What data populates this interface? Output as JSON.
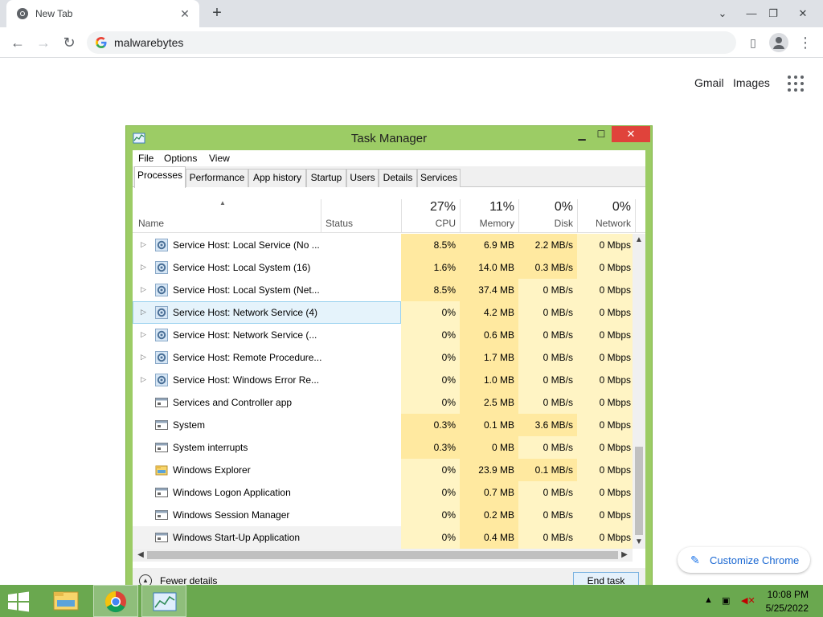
{
  "browser": {
    "tab_title": "New Tab",
    "omnibox_text": "malwarebytes",
    "ntp_links": [
      "Gmail",
      "Images"
    ],
    "customize_label": "Customize Chrome"
  },
  "task_manager": {
    "title": "Task Manager",
    "menu": [
      "File",
      "Options",
      "View"
    ],
    "tabs": [
      "Processes",
      "Performance",
      "App history",
      "Startup",
      "Users",
      "Details",
      "Services"
    ],
    "active_tab": "Processes",
    "columns": {
      "name": "Name",
      "status": "Status",
      "cpu": {
        "pct": "27%",
        "label": "CPU"
      },
      "memory": {
        "pct": "11%",
        "label": "Memory"
      },
      "disk": {
        "pct": "0%",
        "label": "Disk"
      },
      "network": {
        "pct": "0%",
        "label": "Network"
      }
    },
    "rows": [
      {
        "name": "Service Host: Local Service (No ...",
        "expandable": true,
        "icon": "gear-icon",
        "cpu": "8.5%",
        "memory": "6.9 MB",
        "disk": "2.2 MB/s",
        "network": "0 Mbps"
      },
      {
        "name": "Service Host: Local System (16)",
        "expandable": true,
        "icon": "gear-icon",
        "cpu": "1.6%",
        "memory": "14.0 MB",
        "disk": "0.3 MB/s",
        "network": "0 Mbps"
      },
      {
        "name": "Service Host: Local System (Net...",
        "expandable": true,
        "icon": "gear-icon",
        "cpu": "8.5%",
        "memory": "37.4 MB",
        "disk": "0 MB/s",
        "network": "0 Mbps"
      },
      {
        "name": "Service Host: Network Service (4)",
        "expandable": true,
        "icon": "gear-icon",
        "cpu": "0%",
        "memory": "4.2 MB",
        "disk": "0 MB/s",
        "network": "0 Mbps"
      },
      {
        "name": "Service Host: Network Service (...",
        "expandable": true,
        "icon": "gear-icon",
        "cpu": "0%",
        "memory": "0.6 MB",
        "disk": "0 MB/s",
        "network": "0 Mbps"
      },
      {
        "name": "Service Host: Remote Procedure...",
        "expandable": true,
        "icon": "gear-icon",
        "cpu": "0%",
        "memory": "1.7 MB",
        "disk": "0 MB/s",
        "network": "0 Mbps"
      },
      {
        "name": "Service Host: Windows Error Re...",
        "expandable": true,
        "icon": "gear-icon",
        "cpu": "0%",
        "memory": "1.0 MB",
        "disk": "0 MB/s",
        "network": "0 Mbps"
      },
      {
        "name": "Services and Controller app",
        "expandable": false,
        "icon": "window-icon",
        "cpu": "0%",
        "memory": "2.5 MB",
        "disk": "0 MB/s",
        "network": "0 Mbps"
      },
      {
        "name": "System",
        "expandable": false,
        "icon": "window-icon",
        "cpu": "0.3%",
        "memory": "0.1 MB",
        "disk": "3.6 MB/s",
        "network": "0 Mbps"
      },
      {
        "name": "System interrupts",
        "expandable": false,
        "icon": "window-icon",
        "cpu": "0.3%",
        "memory": "0 MB",
        "disk": "0 MB/s",
        "network": "0 Mbps"
      },
      {
        "name": "Windows Explorer",
        "expandable": false,
        "icon": "folder-icon",
        "cpu": "0%",
        "memory": "23.9 MB",
        "disk": "0.1 MB/s",
        "network": "0 Mbps"
      },
      {
        "name": "Windows Logon Application",
        "expandable": false,
        "icon": "window-icon",
        "cpu": "0%",
        "memory": "0.7 MB",
        "disk": "0 MB/s",
        "network": "0 Mbps"
      },
      {
        "name": "Windows Session Manager",
        "expandable": false,
        "icon": "window-icon",
        "cpu": "0%",
        "memory": "0.2 MB",
        "disk": "0 MB/s",
        "network": "0 Mbps"
      },
      {
        "name": "Windows Start-Up Application",
        "expandable": false,
        "icon": "window-icon",
        "cpu": "0%",
        "memory": "0.4 MB",
        "disk": "0 MB/s",
        "network": "0 Mbps"
      }
    ],
    "selected_row": "Service Host: Network Service (4)",
    "fewer_details_label": "Fewer details",
    "end_task_label": "End task"
  },
  "taskbar": {
    "time": "10:08 PM",
    "date": "5/25/2022",
    "pinned": [
      "file-explorer-icon",
      "chrome-icon",
      "task-manager-icon"
    ]
  },
  "colors": {
    "window_frame": "#9ccc65",
    "taskbar": "#6aa84f",
    "close_button": "#e0433b",
    "heat_light": "#fff4c4",
    "heat_medium": "#ffe9a0",
    "selection": "#e5f3fb"
  }
}
